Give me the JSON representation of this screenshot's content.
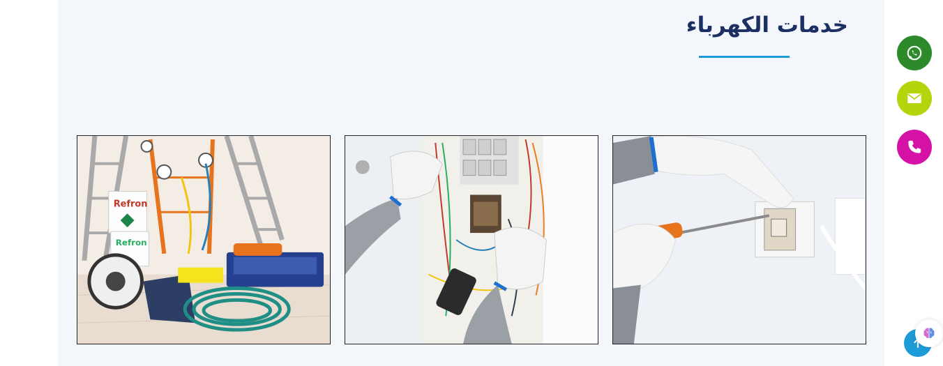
{
  "section": {
    "title": "خدمات الكهرباء"
  },
  "cards": [
    {
      "name": "tools-equipment-image",
      "icon": "tools-photo"
    },
    {
      "name": "electric-panel-image",
      "icon": "panel-photo"
    },
    {
      "name": "switch-repair-image",
      "icon": "switch-photo"
    }
  ],
  "floating_buttons": [
    {
      "name": "whatsapp-button",
      "icon": "whatsapp-icon",
      "color": "#2d8a2a"
    },
    {
      "name": "email-button",
      "icon": "envelope-icon",
      "color": "#b6d40b"
    },
    {
      "name": "phone-button",
      "icon": "phone-icon",
      "color": "#d412a6"
    }
  ],
  "colors": {
    "section_bg": "#f3f7fb",
    "title": "#1b2f63",
    "accent": "#1d9bd8"
  }
}
